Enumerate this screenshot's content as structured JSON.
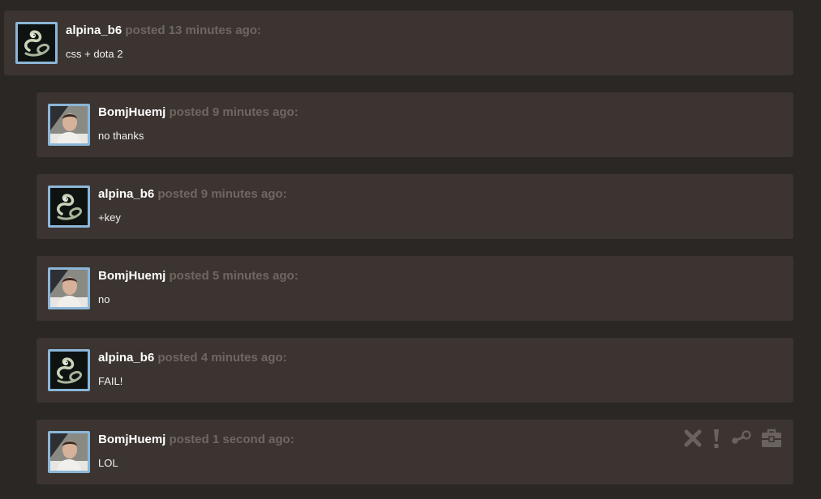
{
  "thread": {
    "posts": [
      {
        "author": "alpina_b6",
        "meta": "posted 13 minutes ago:",
        "body": "css + dota 2",
        "avatar": "serpent-avatar"
      },
      {
        "author": "BomjHuemj",
        "meta": "posted 9 minutes ago:",
        "body": "no thanks",
        "avatar": "person-photo-avatar"
      },
      {
        "author": "alpina_b6",
        "meta": "posted 9 minutes ago:",
        "body": "+key",
        "avatar": "serpent-avatar"
      },
      {
        "author": "BomjHuemj",
        "meta": "posted 5 minutes ago:",
        "body": "no",
        "avatar": "person-photo-avatar"
      },
      {
        "author": "alpina_b6",
        "meta": "posted 4 minutes ago:",
        "body": "FAIL!",
        "avatar": "serpent-avatar"
      },
      {
        "author": "BomjHuemj",
        "meta": "posted 1 second ago:",
        "body": "LOL",
        "avatar": "person-photo-avatar",
        "actions": [
          "delete-icon",
          "report-icon",
          "steam-icon",
          "trade-icon"
        ]
      }
    ]
  },
  "colors": {
    "page_background": "#2a2725",
    "post_background": "#3b3430",
    "author_text": "#ffffff",
    "meta_text": "#6f6761",
    "avatar_border": "#8bb6d8",
    "action_icons": "#6a625c"
  }
}
